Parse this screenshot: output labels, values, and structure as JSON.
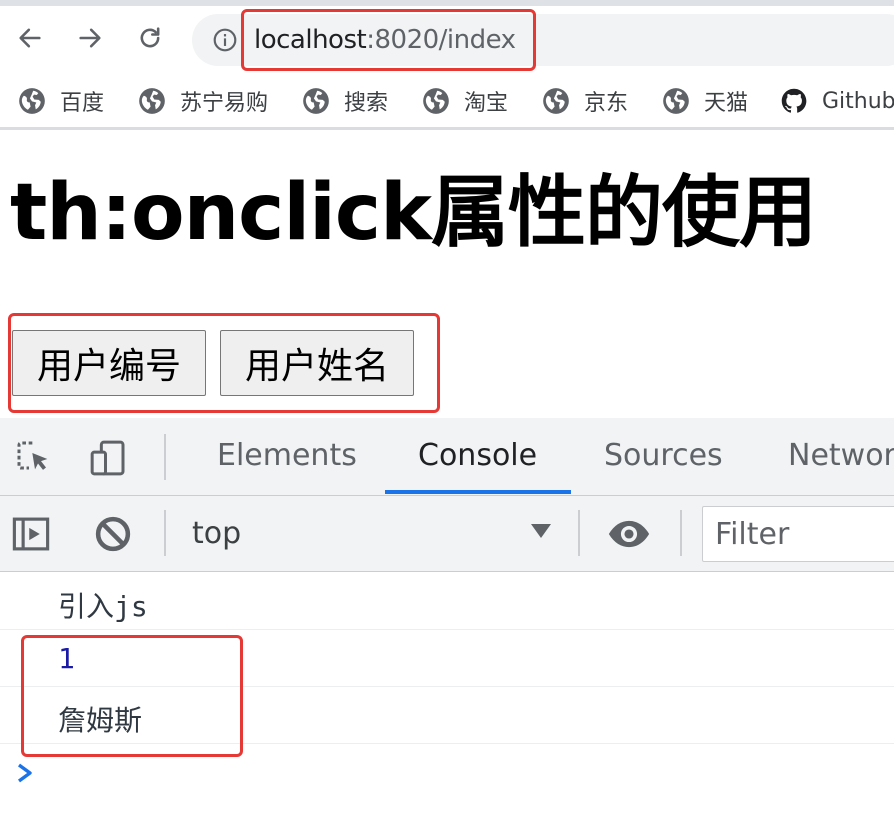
{
  "browser": {
    "address": {
      "host": "localhost",
      "rest": ":8020/index"
    },
    "bookmarks": [
      "百度",
      "苏宁易购",
      "搜索",
      "淘宝",
      "京东",
      "天猫",
      "Github"
    ]
  },
  "page": {
    "title": "th:onclick属性的使用",
    "buttons": [
      "用户编号",
      "用户姓名"
    ]
  },
  "devtools": {
    "tabs": [
      "Elements",
      "Console",
      "Sources",
      "Network"
    ],
    "active_tab": "Console",
    "context": "top",
    "filter_placeholder": "Filter",
    "logs": [
      "引入js",
      "1",
      "詹姆斯"
    ]
  },
  "colors": {
    "highlight": "#e53935",
    "active_tab_underline": "#1a73e8",
    "number_log": "#1a1aa6",
    "prompt": "#1a73e8"
  },
  "icons": {
    "back": "arrow-left-icon",
    "forward": "arrow-right-icon",
    "reload": "reload-icon",
    "site_info": "info-icon",
    "bookmark": "globe-icon",
    "github": "github-icon",
    "inspect": "inspect-element-icon",
    "device": "device-toolbar-icon",
    "sidebar": "sidebar-toggle-icon",
    "clear": "clear-console-icon",
    "live_expression": "eye-icon",
    "prompt": "chevron-right-icon"
  }
}
